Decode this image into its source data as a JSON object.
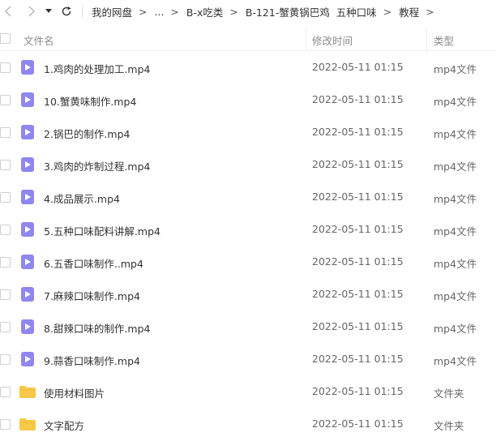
{
  "nav": {
    "back_icon": "chevron-left-icon",
    "forward_icon": "chevron-right-icon",
    "dropdown_icon": "caret-down-icon",
    "refresh_icon": "refresh-icon"
  },
  "breadcrumb": {
    "items": [
      "我的网盘",
      "...",
      "B-x吃类",
      "B-121-蟹黄锅巴鸡  五种口味",
      "教程"
    ],
    "separator": ">"
  },
  "table": {
    "headers": {
      "name": "文件名",
      "modified": "修改时间",
      "type": "类型"
    },
    "rows": [
      {
        "name": "1.鸡肉的处理加工.mp4",
        "modified": "2022-05-11 01:15",
        "type": "mp4文件",
        "icon": "video-file-icon"
      },
      {
        "name": "10.蟹黄味制作.mp4",
        "modified": "2022-05-11 01:15",
        "type": "mp4文件",
        "icon": "video-file-icon"
      },
      {
        "name": "2.锅巴的制作.mp4",
        "modified": "2022-05-11 01:15",
        "type": "mp4文件",
        "icon": "video-file-icon"
      },
      {
        "name": "3.鸡肉的炸制过程.mp4",
        "modified": "2022-05-11 01:15",
        "type": "mp4文件",
        "icon": "video-file-icon"
      },
      {
        "name": "4.成品展示.mp4",
        "modified": "2022-05-11 01:15",
        "type": "mp4文件",
        "icon": "video-file-icon"
      },
      {
        "name": "5.五种口味配料讲解.mp4",
        "modified": "2022-05-11 01:15",
        "type": "mp4文件",
        "icon": "video-file-icon"
      },
      {
        "name": "6.五香口味制作..mp4",
        "modified": "2022-05-11 01:15",
        "type": "mp4文件",
        "icon": "video-file-icon"
      },
      {
        "name": "7.麻辣口味制作.mp4",
        "modified": "2022-05-11 01:15",
        "type": "mp4文件",
        "icon": "video-file-icon"
      },
      {
        "name": "8.甜辣口味的制作.mp4",
        "modified": "2022-05-11 01:15",
        "type": "mp4文件",
        "icon": "video-file-icon"
      },
      {
        "name": "9.蒜香口味制作.mp4",
        "modified": "2022-05-11 01:15",
        "type": "mp4文件",
        "icon": "video-file-icon"
      },
      {
        "name": "使用材料图片",
        "modified": "2022-05-11 01:15",
        "type": "文件夹",
        "icon": "folder-icon"
      },
      {
        "name": "文字配方",
        "modified": "2022-05-11 01:15",
        "type": "文件夹",
        "icon": "folder-icon"
      }
    ]
  },
  "colors": {
    "video_icon": "#8f86f0",
    "folder_icon": "#f7c948"
  }
}
